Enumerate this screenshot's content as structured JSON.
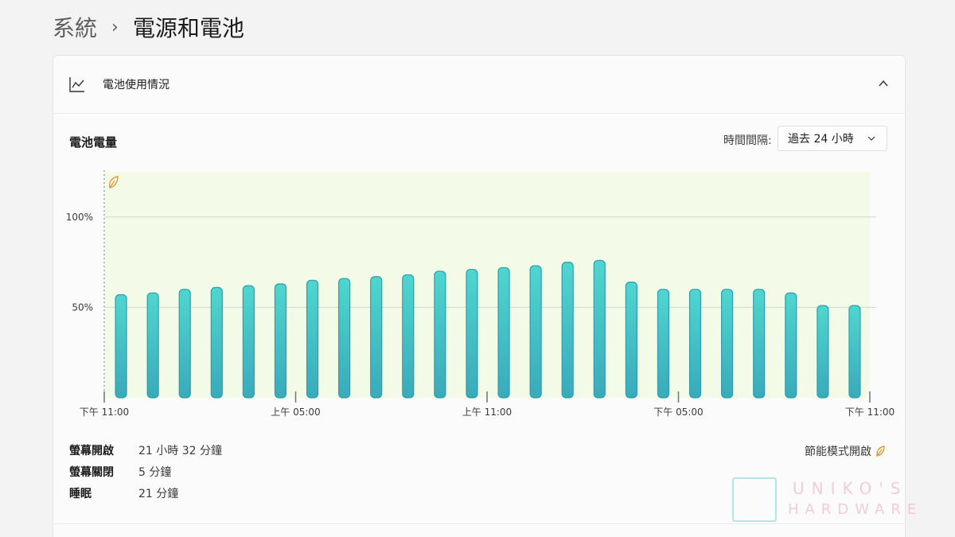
{
  "breadcrumb": {
    "parent": "系統",
    "separator": "›",
    "current": "電源和電池"
  },
  "panel": {
    "title": "電池使用情況",
    "icon": "line-chart-icon",
    "collapse_icon": "chevron-up-icon"
  },
  "battery_level": {
    "title": "電池電量",
    "interval_label": "時間間隔:",
    "interval_value": "過去 24 小時",
    "interval_icon": "chevron-down-icon"
  },
  "chart_data": {
    "type": "bar",
    "ylabel": "",
    "xlabel": "",
    "ylim": [
      0,
      125
    ],
    "yticks": [
      {
        "value": 100,
        "label": "100%"
      },
      {
        "value": 50,
        "label": "50%"
      }
    ],
    "x_ticks": [
      {
        "index": 0,
        "label": "下午 11:00"
      },
      {
        "index": 6,
        "label": "上午 05:00"
      },
      {
        "index": 12,
        "label": "上午 11:00"
      },
      {
        "index": 18,
        "label": "下午 05:00"
      },
      {
        "index": 24,
        "label": "下午 11:00"
      }
    ],
    "values": [
      57,
      58,
      60,
      61,
      62,
      63,
      65,
      66,
      67,
      68,
      70,
      71,
      72,
      73,
      75,
      76,
      64,
      60,
      60,
      60,
      60,
      58,
      51,
      51
    ],
    "battery_saver_marker": {
      "index": 0,
      "icon": "leaf-icon"
    },
    "grid": true,
    "colors": {
      "bar_top": "#4fd6cf",
      "bar_bottom": "#3aaabb",
      "bar_stroke": "#2f9fa7",
      "saver_fill": "#f3fbe8",
      "leaf": "#d89b3a"
    }
  },
  "stats": [
    {
      "label": "螢幕開啟",
      "value": "21 小時 32 分鐘"
    },
    {
      "label": "螢幕關閉",
      "value": "5 分鐘"
    },
    {
      "label": "睡眠",
      "value": "21 分鐘"
    }
  ],
  "battery_saver_legend": {
    "label": "節能模式開啟",
    "icon": "leaf-icon"
  },
  "watermark": {
    "line1": "UNIKO'S",
    "line2": "HARDWARE"
  }
}
